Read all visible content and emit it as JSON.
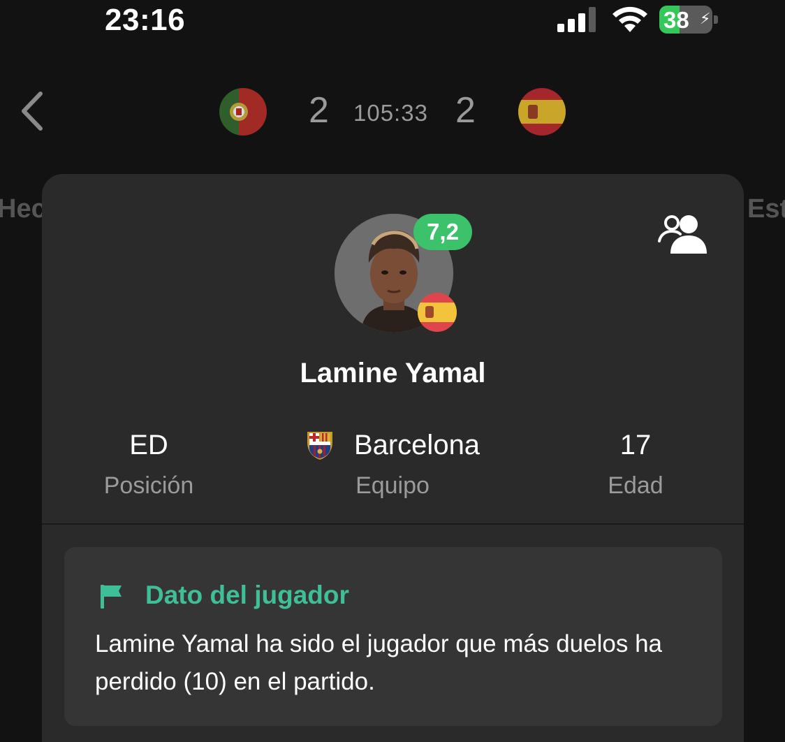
{
  "status_bar": {
    "time": "23:16",
    "battery": "38",
    "battery_percent": 38,
    "battery_color": "#34c759"
  },
  "match": {
    "home_score": "2",
    "away_score": "2",
    "clock": "105:33",
    "home_flag": "portugal-flag",
    "away_flag": "spain-flag"
  },
  "tabs": {
    "left_partial": "Hec",
    "right_partial": "Est"
  },
  "player": {
    "name": "Lamine Yamal",
    "rating": "7,2",
    "rating_color": "#3cc26a",
    "nationality_flag": "spain-flag",
    "position_value": "ED",
    "position_label": "Posición",
    "team_value": "Barcelona",
    "team_label": "Equipo",
    "age_value": "17",
    "age_label": "Edad"
  },
  "fact": {
    "title": "Dato del jugador",
    "text": "Lamine Yamal ha sido el jugador que más duelos ha perdido (10) en el partido.",
    "accent_color": "#3fbf98"
  }
}
